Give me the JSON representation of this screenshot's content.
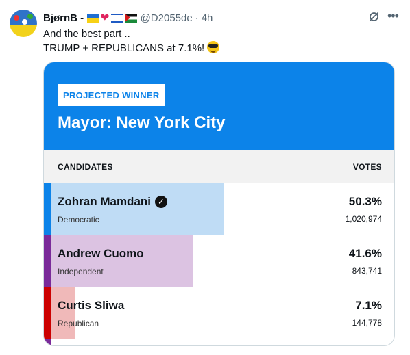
{
  "tweet": {
    "name": "BjørnB -",
    "handle": "@D2055de",
    "separator": "·",
    "time": "4h",
    "text_line1": "And the best part ..",
    "text_line2": "TRUMP + REPUBLICANS at 7.1%!",
    "emoji": "sunglasses-emoji",
    "icons": [
      "grok-icon",
      "more-icon"
    ]
  },
  "card": {
    "badge": "PROJECTED WINNER",
    "title": "Mayor: New York City",
    "col_candidates": "CANDIDATES",
    "col_votes": "VOTES",
    "candidates": [
      {
        "name": "Zohran Mamdani",
        "party": "Democratic",
        "pct": "50.3%",
        "votes": "1,020,974",
        "winner": true,
        "pct_value": 50.3,
        "color": "#0c83e9",
        "fill": "#bfdcf5"
      },
      {
        "name": "Andrew Cuomo",
        "party": "Independent",
        "pct": "41.6%",
        "votes": "843,741",
        "winner": false,
        "pct_value": 41.6,
        "color": "#7a2a9a",
        "fill": "#dcc3e2"
      },
      {
        "name": "Curtis Sliwa",
        "party": "Republican",
        "pct": "7.1%",
        "votes": "144,778",
        "winner": false,
        "pct_value": 7.1,
        "color": "#cc0000",
        "fill": "#f0b9b9"
      }
    ]
  }
}
